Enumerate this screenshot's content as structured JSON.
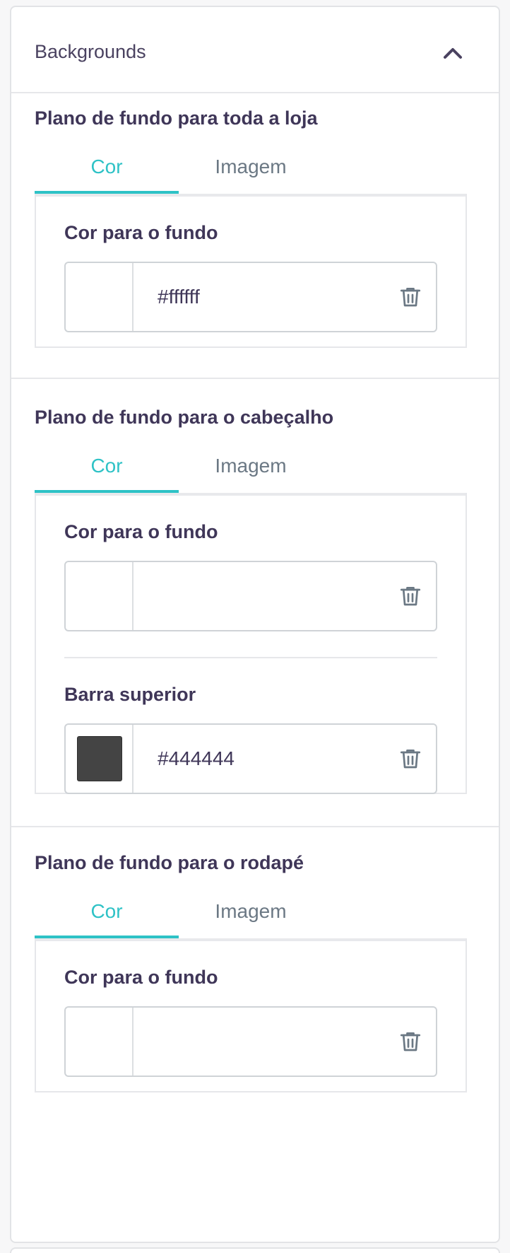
{
  "panel": {
    "title": "Backgrounds",
    "toggle_icon": "chevron-up-icon"
  },
  "sections": [
    {
      "title": "Plano de fundo para toda a loja",
      "tabs": [
        "Cor",
        "Imagem"
      ],
      "active_tab": "Cor",
      "fields": [
        {
          "label": "Cor para o fundo",
          "value": "#ffffff",
          "swatch_color": "#ffffff"
        }
      ]
    },
    {
      "title": "Plano de fundo para o cabeçalho",
      "tabs": [
        "Cor",
        "Imagem"
      ],
      "active_tab": "Cor",
      "fields": [
        {
          "label": "Cor para o fundo",
          "value": "",
          "swatch_color": ""
        },
        {
          "label": "Barra superior",
          "value": "#444444",
          "swatch_color": "#444444"
        }
      ]
    },
    {
      "title": "Plano de fundo para o rodapé",
      "tabs": [
        "Cor",
        "Imagem"
      ],
      "active_tab": "Cor",
      "fields": [
        {
          "label": "Cor para o fundo",
          "value": "",
          "swatch_color": ""
        }
      ]
    }
  ],
  "icons": {
    "delete": "trash-icon"
  },
  "colors": {
    "accent": "#2ec2c6",
    "text": "#3f3658",
    "muted_text": "#6b7884",
    "border": "#e6e7ea"
  }
}
